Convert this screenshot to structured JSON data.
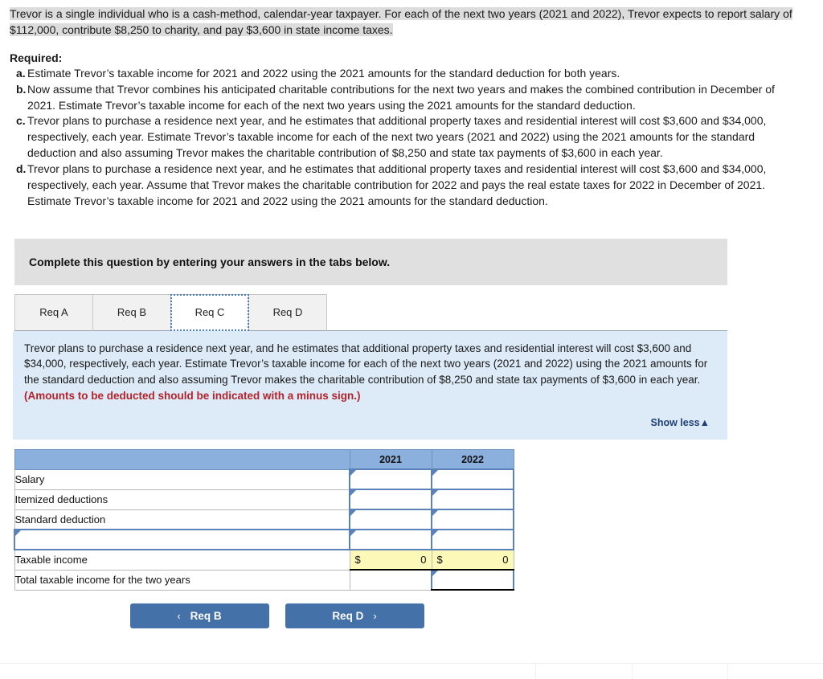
{
  "stem": {
    "text": "Trevor is a single individual who is a cash-method, calendar-year taxpayer. For each of the next two years (2021 and 2022), Trevor expects to report salary of $112,000, contribute $8,250 to charity, and pay $3,600 in state income taxes."
  },
  "required": {
    "heading": "Required:",
    "items": [
      {
        "marker": "a.",
        "text": "Estimate Trevor’s taxable income for 2021 and 2022 using the 2021 amounts for the standard deduction for both years."
      },
      {
        "marker": "b.",
        "text": "Now assume that Trevor combines his anticipated charitable contributions for the next two years and makes the combined contribution in December of 2021. Estimate Trevor’s taxable income for each of the next two years using the 2021 amounts for the standard deduction."
      },
      {
        "marker": "c.",
        "text": "Trevor plans to purchase a residence next year, and he estimates that additional property taxes and residential interest will cost $3,600 and $34,000, respectively, each year. Estimate Trevor’s taxable income for each of the next two years (2021 and 2022) using the 2021 amounts for the standard deduction and also assuming Trevor makes the charitable contribution of $8,250 and state tax payments of $3,600 in each year."
      },
      {
        "marker": "d.",
        "text": "Trevor plans to purchase a residence next year, and he estimates that additional property taxes and residential interest will cost $3,600 and $34,000, respectively, each year. Assume that Trevor makes the charitable contribution for 2022 and pays the real estate taxes for 2022 in December of 2021. Estimate Trevor’s taxable income for 2021 and 2022 using the 2021 amounts for the standard deduction."
      }
    ]
  },
  "banner": {
    "text": "Complete this question by entering your answers in the tabs below."
  },
  "tabs": {
    "items": [
      {
        "label": "Req A",
        "active": false
      },
      {
        "label": "Req B",
        "active": false
      },
      {
        "label": "Req C",
        "active": true
      },
      {
        "label": "Req D",
        "active": false
      }
    ],
    "active_label": "Req C"
  },
  "info_panel": {
    "body": "Trevor plans to purchase a residence next year, and he estimates that additional property taxes and residential interest will cost $3,600 and $34,000, respectively, each year. Estimate Trevor’s taxable income for each of the next two years (2021 and 2022) using the 2021 amounts for the standard deduction and also assuming Trevor makes the charitable contribution of $8,250 and state tax payments of $3,600 in each year. ",
    "warning": "(Amounts to be deducted should be indicated with a minus sign.)",
    "show_less_label": "Show less",
    "show_less_caret": "▲"
  },
  "answer_table": {
    "columns": [
      "",
      "2021",
      "2022"
    ],
    "rows": [
      {
        "label": "Salary",
        "label_editable": false,
        "y2021": "",
        "y2022": "",
        "type": "input"
      },
      {
        "label": "Itemized deductions",
        "label_editable": false,
        "y2021": "",
        "y2022": "",
        "type": "input"
      },
      {
        "label": "Standard deduction",
        "label_editable": false,
        "y2021": "",
        "y2022": "",
        "type": "input"
      },
      {
        "label": "",
        "label_editable": true,
        "y2021": "",
        "y2022": "",
        "type": "input"
      },
      {
        "label": "Taxable income",
        "label_editable": false,
        "y2021": "0",
        "y2022": "0",
        "type": "total",
        "currency": "$"
      },
      {
        "label": "Total taxable income for the two years",
        "label_editable": false,
        "y2021": null,
        "y2022": "",
        "type": "grandtotal"
      }
    ],
    "currency_symbol": "$"
  },
  "nav": {
    "prev_label": "Req B",
    "prev_icon": "‹",
    "next_label": "Req D",
    "next_icon": "›"
  },
  "colors": {
    "table_header_blue": "#8cb0de",
    "input_border_blue": "#5a82b8",
    "total_yellow": "#fbf8b8",
    "panel_blue": "#ddeaf7",
    "banner_grey": "#e0e0e0",
    "button_blue": "#4472a8",
    "warning_red": "#b4232a",
    "link_blue": "#1f3f77",
    "highlight_grey": "#dcdcdc"
  }
}
